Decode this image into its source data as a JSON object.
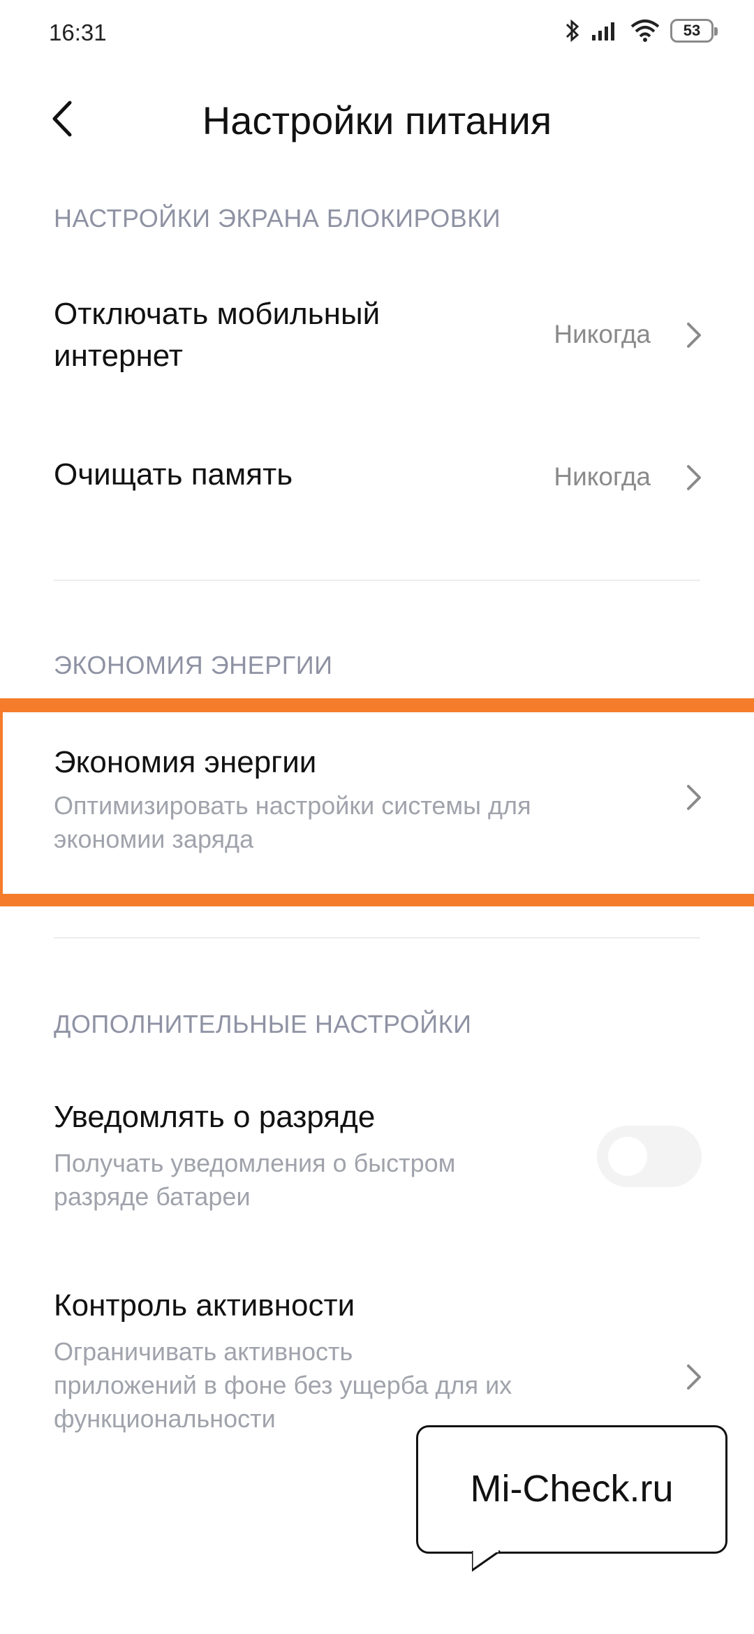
{
  "status_bar": {
    "time": "16:31",
    "battery": "53"
  },
  "header": {
    "title": "Настройки питания"
  },
  "sections": {
    "lock_screen": {
      "title": "НАСТРОЙКИ ЭКРАНА БЛОКИРОВКИ",
      "items": [
        {
          "title_line1": "Отключать мобильный",
          "title_line2": "интернет",
          "value": "Никогда"
        },
        {
          "title_line1": "Очищать память",
          "value": "Никогда"
        }
      ]
    },
    "energy": {
      "title": "ЭКОНОМИЯ ЭНЕРГИИ",
      "item": {
        "title": "Экономия энергии",
        "sub_line1": "Оптимизировать настройки системы для",
        "sub_line2": "экономии заряда"
      }
    },
    "additional": {
      "title": "ДОПОЛНИТЕЛЬНЫЕ НАСТРОЙКИ",
      "notify": {
        "title": "Уведомлять о разряде",
        "sub_line1": "Получать уведомления о быстром",
        "sub_line2": "разряде батареи",
        "toggle_on": false
      },
      "activity": {
        "title": "Контроль активности",
        "sub_line1": "Ограничивать активность",
        "sub_line2": "приложений в фоне без ущерба для их",
        "sub_line3": "функциональности"
      }
    }
  },
  "watermark": {
    "text": "Mi-Check.ru"
  },
  "colors": {
    "accent_highlight": "#f57c2b",
    "section_header": "#8e92a3"
  }
}
